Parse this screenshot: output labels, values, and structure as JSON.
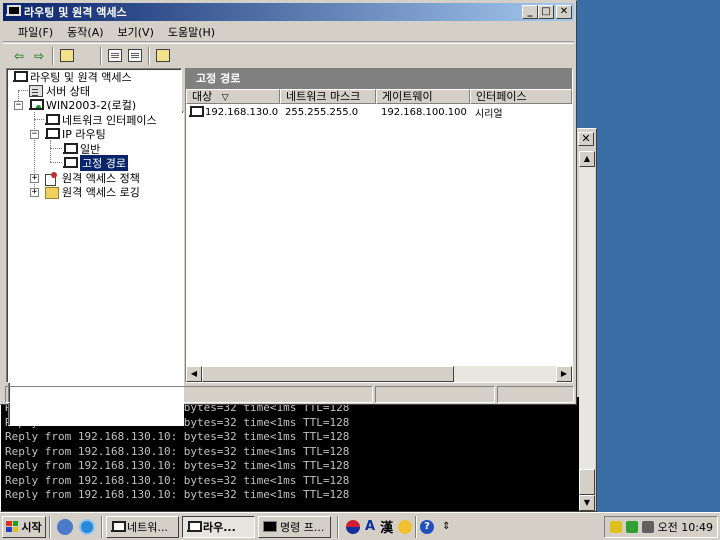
{
  "console": {
    "close_glyph": "✕",
    "lines": [
      "Reply from 192.168.130.10: bytes=32 time<1ms TTL=128",
      "Reply from 192.168.130.10: bytes=32 time<1ms TTL=128",
      "Reply from 192.168.130.10: bytes=32 time<1ms TTL=128",
      "Reply from 192.168.130.10: bytes=32 time<1ms TTL=128",
      "Reply from 192.168.130.10: bytes=32 time<1ms TTL=128",
      "Reply from 192.168.130.10: bytes=32 time<1ms TTL=128",
      "Reply from 192.168.130.10: bytes=32 time<1ms TTL=128"
    ]
  },
  "window": {
    "title": "라우팅 및 원격 액세스",
    "minimize_glyph": "_",
    "maximize_glyph": "□",
    "close_glyph": "✕"
  },
  "menu": [
    "파일(F)",
    "동작(A)",
    "보기(V)",
    "도움말(H)"
  ],
  "toolbar": {
    "back_glyph": "⇦",
    "forward_glyph": "⇨"
  },
  "tree": {
    "root": "라우팅 및 원격 액세스",
    "server_status": "서버 상태",
    "server": "WIN2003-2(로컬)",
    "network_interfaces": "네트워크 인터페이스",
    "ip_routing": "IP 라우팅",
    "general": "일반",
    "static_routes": "고정 경로",
    "remote_access_policy": "원격 액세스 정책",
    "remote_access_logging": "원격 액세스 로깅",
    "expand_glyph": "+",
    "collapse_glyph": "−"
  },
  "panel": {
    "header": "고정 경로",
    "columns": [
      "대상",
      "네트워크 마스크",
      "게이트웨이",
      "인터페이스"
    ],
    "sort_glyph": "▽",
    "rows": [
      {
        "dest": "192.168.130.0",
        "mask": "255.255.255.0",
        "gateway": "192.168.100.100",
        "iface": "시리얼"
      }
    ]
  },
  "taskbar": {
    "start": "시작",
    "tasks": [
      "네트워...",
      "라우...",
      "명령 프..."
    ],
    "ime_a": "A",
    "ime_han": "漢",
    "clock": "오전 10:49",
    "help_glyph": "?"
  },
  "colors": {
    "desktop": "#3a6ea5",
    "titlebar_start": "#0a246a",
    "titlebar_end": "#a6caf0",
    "selection": "#0a246a",
    "panel_header": "#808080"
  }
}
